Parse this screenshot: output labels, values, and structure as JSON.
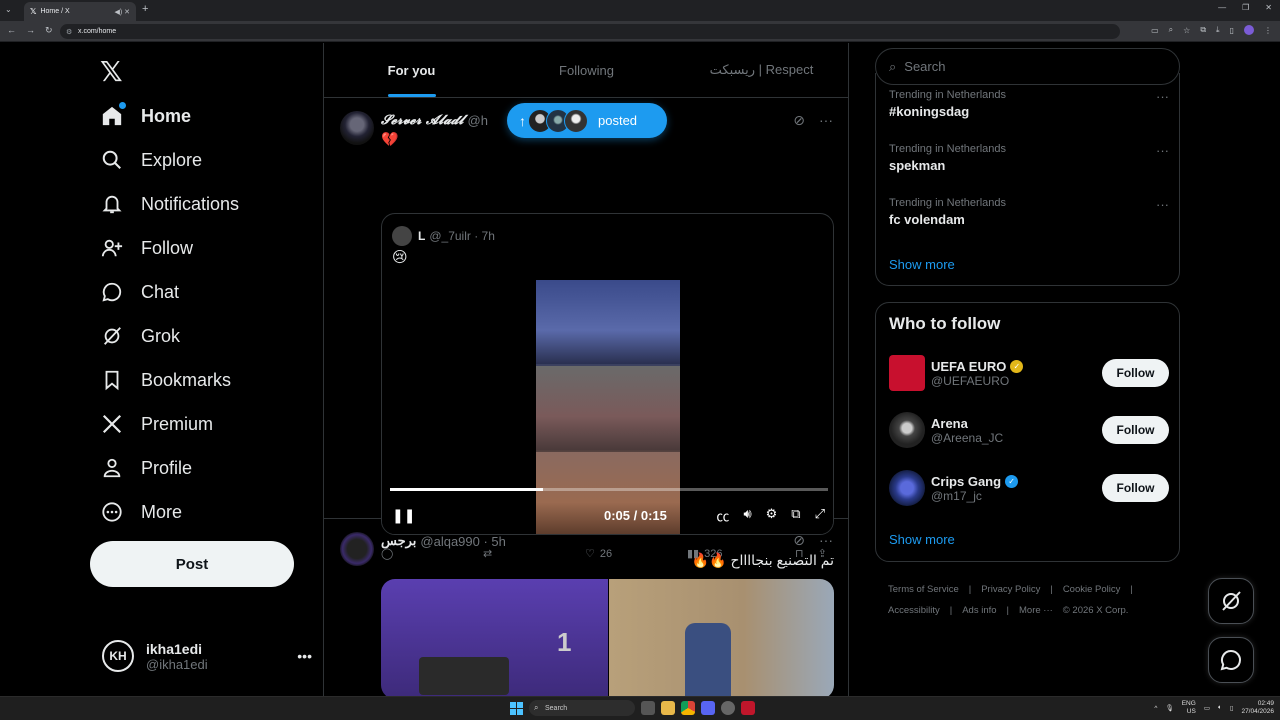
{
  "browser": {
    "tab_title": "Home / X",
    "url": "x.com/home"
  },
  "sidebar": {
    "items": [
      {
        "label": "Home",
        "icon": "home-icon"
      },
      {
        "label": "Explore",
        "icon": "search-icon"
      },
      {
        "label": "Notifications",
        "icon": "bell-icon"
      },
      {
        "label": "Follow",
        "icon": "add-person-icon"
      },
      {
        "label": "Chat",
        "icon": "chat-bubble-icon"
      },
      {
        "label": "Grok",
        "icon": "grok-icon"
      },
      {
        "label": "Bookmarks",
        "icon": "bookmark-icon"
      },
      {
        "label": "Premium",
        "icon": "x-icon"
      },
      {
        "label": "Profile",
        "icon": "person-icon"
      },
      {
        "label": "More",
        "icon": "more-circle-icon"
      }
    ],
    "post_label": "Post",
    "account": {
      "initials": "KH",
      "name": "ikha1edi",
      "handle": "@ikha1edi"
    }
  },
  "main": {
    "tabs": [
      "For you",
      "Following",
      "ريسبكت | Respect"
    ],
    "posted_pill": "posted",
    "tweet1": {
      "name": "𝓢𝓮𝓻𝓿𝓮𝓻 𝓐𝓵𝓪𝓭𝓵",
      "handle": "@h",
      "text": "💔",
      "quote": {
        "name": "L",
        "handle": "@_7uilr · 7h",
        "text": "😢",
        "video_time": "0:05 / 0:15",
        "progress": 0.35
      },
      "replies": "",
      "reposts": "",
      "likes": "26",
      "views": "326"
    },
    "tweet2": {
      "name": "برجس",
      "handle": "@alqa990 · 5h",
      "text": "تم التصنيع بنجااااح 🔥🔥",
      "media_number": "1"
    }
  },
  "right": {
    "search_placeholder": "Search",
    "trends": [
      {
        "context": "Trending in Netherlands",
        "topic": "#koningsdag"
      },
      {
        "context": "Trending in Netherlands",
        "topic": "spekman"
      },
      {
        "context": "Trending in Netherlands",
        "topic": "fc volendam"
      }
    ],
    "show_more": "Show more",
    "who_to_follow": {
      "title": "Who to follow",
      "accounts": [
        {
          "name": "UEFA EURO",
          "handle": "@UEFAEURO",
          "badge": "gold",
          "avatar_color": "#c8102e"
        },
        {
          "name": "Arena",
          "handle": "@Areena_JC",
          "badge": "",
          "avatar_color": "#3a3a3a"
        },
        {
          "name": "Crips Gang",
          "handle": "@m17_jc",
          "badge": "blue",
          "avatar_color": "#2a3a8a"
        }
      ],
      "follow_label": "Follow",
      "show_more": "Show more"
    },
    "footer": [
      "Terms of Service",
      "|",
      "Privacy Policy",
      "|",
      "Cookie Policy",
      "|",
      "Accessibility",
      "|",
      "Ads info",
      "|",
      "More ···",
      "© 2026 X Corp."
    ]
  },
  "taskbar": {
    "search": "Search",
    "lang": "ENG",
    "region": "US",
    "time": "02:49",
    "date": "27/04/2026"
  },
  "colors": {
    "accent": "#1d9bf0",
    "background": "#000000",
    "border": "#2f3336",
    "muted_text": "#71767b"
  }
}
